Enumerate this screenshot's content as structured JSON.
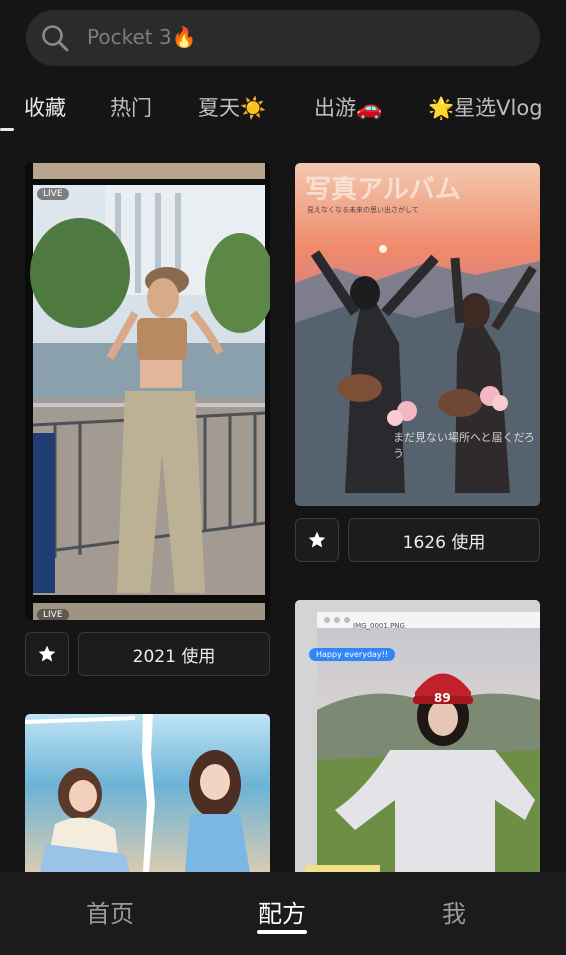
{
  "search": {
    "placeholder": "Pocket 3🔥",
    "icon": "search-icon"
  },
  "tabs": [
    {
      "label": "收藏",
      "active": true
    },
    {
      "label": "热门",
      "active": false
    },
    {
      "label": "夏天☀️",
      "active": false
    },
    {
      "label": "出游🚗",
      "active": false
    },
    {
      "label": "🌟星选Vlog",
      "active": false
    }
  ],
  "cards": [
    {
      "use_label": "2021 使用",
      "live_label": "LIVE"
    },
    {
      "use_label": "1626 使用",
      "overlay_title": "写真アルバム",
      "overlay_subtitle": "見えなくなる未来の思い出さがして",
      "overlay_caption": "まだ見ない場所へと届くだろう"
    },
    {
      "filename": "IMG_0001.PNG",
      "chat_bubble": "Happy everyday!!",
      "cap_text": "89"
    },
    {}
  ],
  "bottom_nav": [
    {
      "label": "首页",
      "active": false
    },
    {
      "label": "配方",
      "active": true
    },
    {
      "label": "我",
      "active": false
    }
  ],
  "colors": {
    "background": "#151515",
    "surface": "#2b2b2b",
    "text": "#e8e8e8"
  }
}
